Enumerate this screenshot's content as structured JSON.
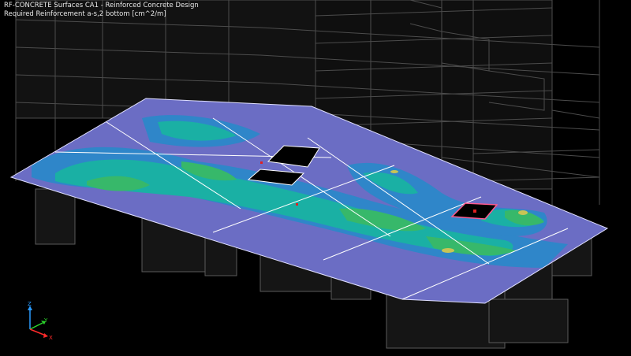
{
  "header": {
    "line1": "RF-CONCRETE Surfaces CA1 - Reinforced Concrete Design",
    "line2": "Required Reinforcement a-s,2 bottom [cm^2/m]"
  },
  "axes": {
    "z": "Z",
    "y": "Y",
    "x": "X"
  },
  "colors": {
    "background": "#000000",
    "wireframe": "#5a5a5a",
    "slab_base": "#6b6dc4",
    "contour_blue": "#2f86c9",
    "contour_teal": "#1ab0a4",
    "contour_green": "#37b86a",
    "contour_yellow": "#c8c455",
    "slab_edge": "#ffffff",
    "axis_x": "#ff2a2a",
    "axis_y": "#2cd62c",
    "axis_z": "#2a9bff"
  }
}
